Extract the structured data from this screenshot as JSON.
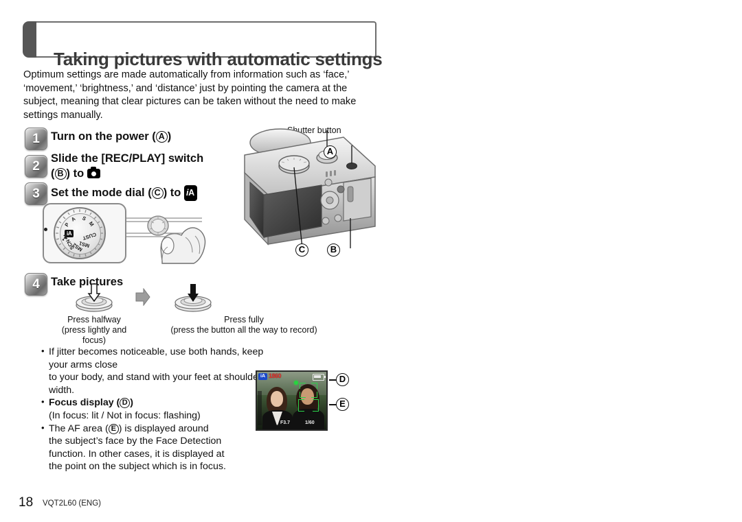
{
  "header": {
    "title": "Taking pictures with automatic settings"
  },
  "intro": {
    "paragraph": "Optimum settings are made automatically from information such as ‘face,’ ‘movement,’ ‘brightness,’ and ‘distance’ just by pointing the camera at the subject, meaning that clear pictures can be taken without the need to make settings manually."
  },
  "steps": [
    {
      "number": "1",
      "line1_pre": "Turn on the power (",
      "ref": "A",
      "line1_post": ")"
    },
    {
      "number": "2",
      "line1_pre": "Slide the [REC/PLAY] switch",
      "line2_pre": "(",
      "ref": "B",
      "line2_mid": ") to ",
      "icon": "camera-icon"
    },
    {
      "number": "3",
      "line1_pre": "Set the mode dial (",
      "ref": "C",
      "line1_post": ") to ",
      "icon": "ia-badge-icon"
    },
    {
      "number": "4",
      "line1_pre": "Take pictures"
    }
  ],
  "mode_dial": {
    "labels": [
      "P",
      "A",
      "S",
      "M",
      "CUST",
      "MS1",
      "MS2",
      "SCN"
    ],
    "selected": "iA"
  },
  "camera_figure": {
    "shutter_label": "Shutter button",
    "callouts": [
      "A",
      "B",
      "C"
    ]
  },
  "press": {
    "halfway_title": "Press halfway",
    "halfway_sub": "(press lightly and focus)",
    "fully_title": "Press fully",
    "fully_sub": "(press the button all the way to record)"
  },
  "bullets": {
    "jitter_line1": "If jitter becomes noticeable, use both hands, keep your arms close",
    "jitter_line2": "to your body, and stand with your feet at shoulder width.",
    "focus_display_pre": "Focus display (",
    "focus_display_ref": "D",
    "focus_display_post": ")",
    "focus_display_sub": "(In focus: lit / Not in focus: flashing)",
    "af_line1_pre": "The AF area (",
    "af_line1_ref": "E",
    "af_line1_post": ") is displayed around",
    "af_line2": "the subject’s face by the Face Detection",
    "af_line3": "function. In other cases, it is displayed at",
    "af_line4": "the point on the subject which is in focus."
  },
  "lcd": {
    "mode_icon": "iA",
    "counter": "1860",
    "aperture": "F3.7",
    "shutter": "1/60",
    "callout_d": "D",
    "callout_e": "E"
  },
  "footer": {
    "page_number": "18",
    "doc_code": "VQT2L60 (ENG)"
  },
  "colors": {
    "title_tab": "#565656",
    "title_text": "#3a3a3a",
    "af_green": "#2bd44a",
    "lcd_red": "#e2302a",
    "lcd_blue": "#1b49c8"
  }
}
